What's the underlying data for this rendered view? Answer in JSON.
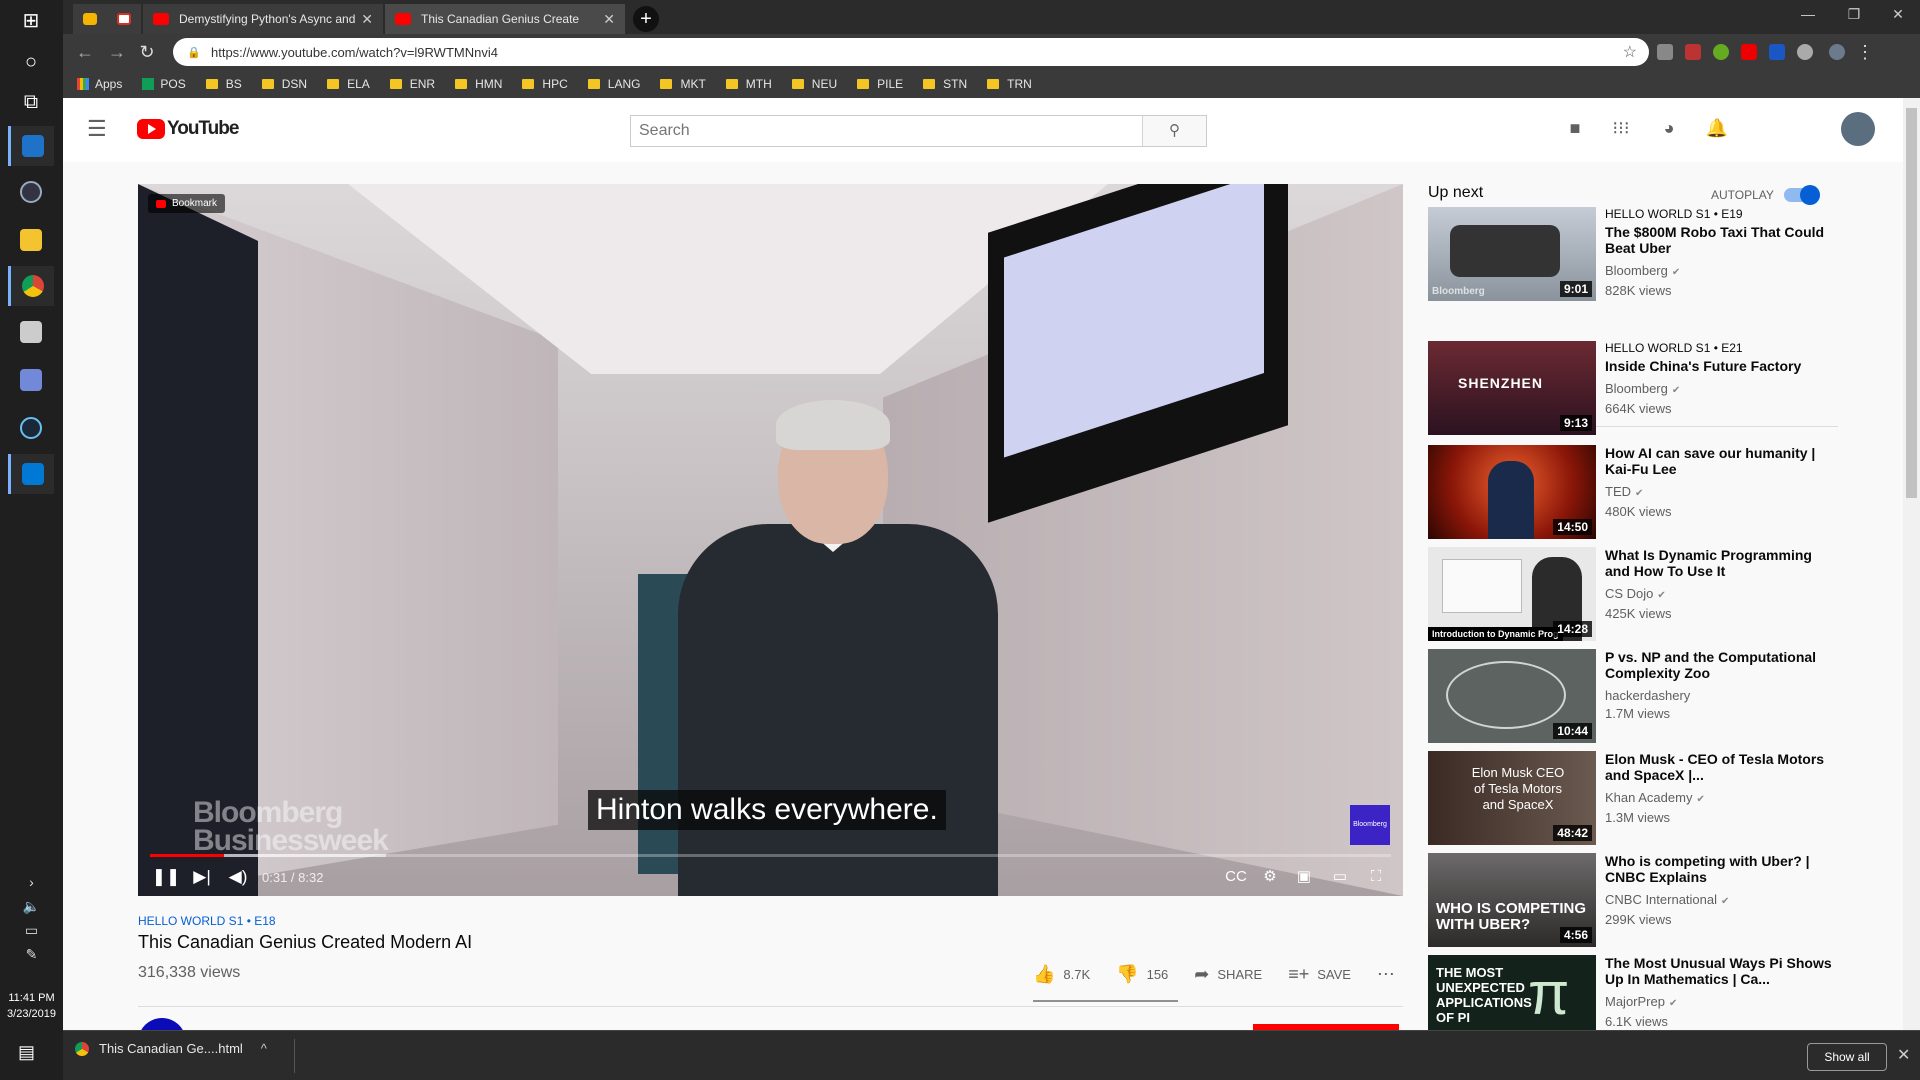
{
  "browser": {
    "tabs": [
      {
        "title": ""
      },
      {
        "title": ""
      },
      {
        "title": "Demystifying Python's Async and"
      },
      {
        "title": "This Canadian Genius Create"
      }
    ],
    "url": "https://www.youtube.com/watch?v=l9RWTMNnvi4",
    "bookmarks": [
      "Apps",
      "POS",
      "BS",
      "DSN",
      "ELA",
      "ENR",
      "HMN",
      "HPC",
      "LANG",
      "MKT",
      "MTH",
      "NEU",
      "PILE",
      "STN",
      "TRN"
    ]
  },
  "youtube": {
    "logo_text": "YouTube",
    "search_placeholder": "Search",
    "player": {
      "bookmark_chip": "Bookmark",
      "watermark_line1": "Bloomberg",
      "watermark_line2": "Businessweek",
      "caption": "Hinton walks everywhere.",
      "badge": "Bloomberg",
      "time": "0:31 / 8:32",
      "progress_played_fraction": 0.06,
      "progress_loaded_fraction": 0.19
    },
    "video": {
      "tag": "HELLO WORLD  S1 • E18",
      "title": "This Canadian Genius Created Modern AI",
      "views": "316,338 views",
      "likes": "8.7K",
      "dislikes": "156",
      "share": "SHARE",
      "save": "SAVE"
    },
    "sidebar": {
      "up_next": "Up next",
      "autoplay": "AUTOPLAY",
      "autoplay_on": true,
      "items": [
        {
          "tag": "HELLO WORLD  S1 • E19",
          "title": "The $800M Robo Taxi That Could Beat Uber",
          "channel": "Bloomberg",
          "views": "828K views",
          "duration": "9:01",
          "thumb_text": "Bloomberg"
        },
        {
          "tag": "HELLO WORLD  S1 • E21",
          "title": "Inside China's Future Factory",
          "channel": "Bloomberg",
          "views": "664K views",
          "duration": "9:13",
          "thumb_text": "SHENZHEN"
        },
        {
          "tag": "",
          "title": "How AI can save our humanity | Kai-Fu Lee",
          "channel": "TED",
          "views": "480K views",
          "duration": "14:50",
          "thumb_text": ""
        },
        {
          "tag": "",
          "title": "What Is Dynamic Programming and How To Use It",
          "channel": "CS Dojo",
          "views": "425K views",
          "duration": "14:28",
          "thumb_text": "Introduction to Dynamic Prog"
        },
        {
          "tag": "",
          "title": "P vs. NP and the Computational Complexity Zoo",
          "channel": "hackerdashery",
          "views": "1.7M views",
          "duration": "10:44",
          "thumb_text": ""
        },
        {
          "tag": "",
          "title": "Elon Musk - CEO of Tesla Motors and SpaceX |...",
          "channel": "Khan Academy",
          "views": "1.3M views",
          "duration": "48:42",
          "thumb_text": "Elon Musk CEO of Tesla Motors and SpaceX"
        },
        {
          "tag": "",
          "title": "Who is competing with Uber? | CNBC Explains",
          "channel": "CNBC International",
          "views": "299K views",
          "duration": "4:56",
          "thumb_text": "WHO IS COMPETING WITH UBER?"
        },
        {
          "tag": "",
          "title": "The Most Unusual Ways Pi Shows Up In Mathematics | Ca...",
          "channel": "MajorPrep",
          "views": "6.1K views",
          "duration": "",
          "thumb_text": "THE MOST UNEXPECTED APPLICATIONS OF PI"
        }
      ]
    }
  },
  "downloads": {
    "file": "This Canadian Ge....html",
    "show_all": "Show all"
  },
  "system": {
    "time": "11:41 PM",
    "date": "3/23/2019"
  }
}
